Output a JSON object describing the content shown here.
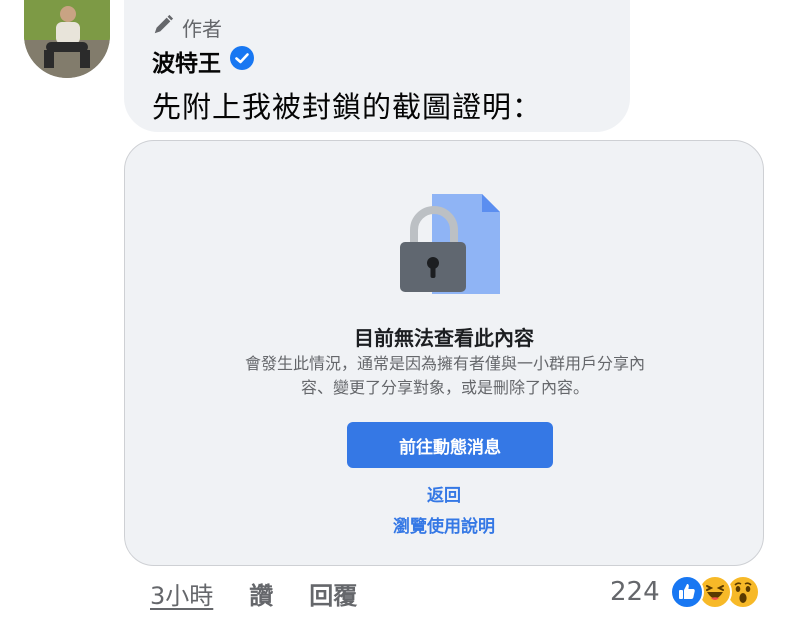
{
  "comment": {
    "author_badge_label": "作者",
    "author_name": "波特王",
    "text": "先附上我被封鎖的截圖證明："
  },
  "attachment": {
    "title": "目前無法查看此內容",
    "description_line1": "會發生此情況，通常是因為擁有者僅與一小群用戶分享內",
    "description_line2": "容、變更了分享對象，或是刪除了內容。",
    "primary_button": "前往動態消息",
    "back_link": "返回",
    "help_link": "瀏覽使用說明"
  },
  "actions": {
    "timestamp": "3小時",
    "like": "讚",
    "reply": "回覆"
  },
  "reactions": {
    "count": "224",
    "types": [
      "like-icon",
      "haha-icon",
      "wow-icon"
    ]
  },
  "colors": {
    "accent": "#3578e5",
    "bubble_bg": "#f0f2f5",
    "verified": "#1877f2"
  }
}
